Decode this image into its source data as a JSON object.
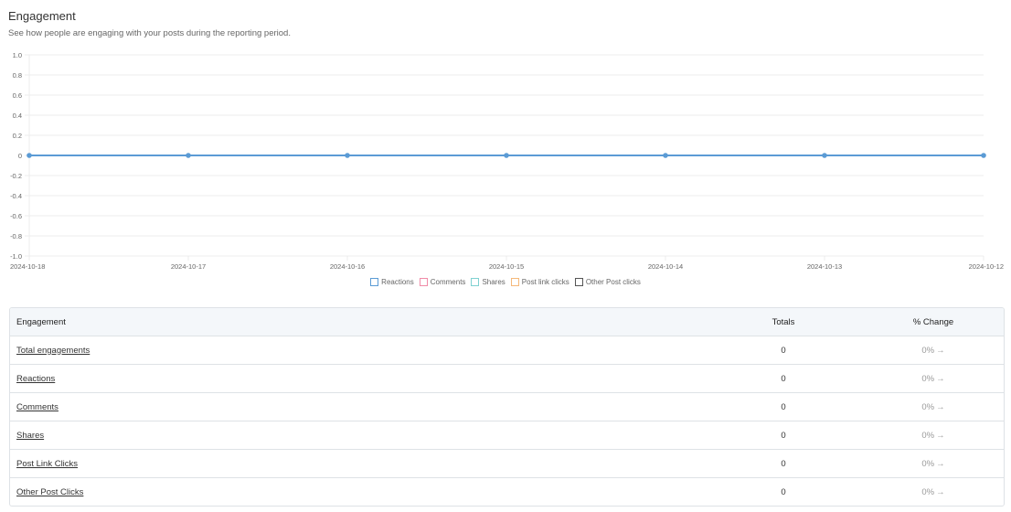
{
  "header": {
    "title": "Engagement",
    "subtitle": "See how people are engaging with your posts during the reporting period."
  },
  "chart_data": {
    "type": "line",
    "x": [
      "2024-10-18",
      "2024-10-17",
      "2024-10-16",
      "2024-10-15",
      "2024-10-14",
      "2024-10-13",
      "2024-10-12"
    ],
    "y_ticks": [
      "1.0",
      "0.8",
      "0.6",
      "0.4",
      "0.2",
      "0",
      "-0.2",
      "-0.4",
      "-0.6",
      "-0.8",
      "-1.0"
    ],
    "ylim": [
      -1.0,
      1.0
    ],
    "grid": true,
    "legend_position": "bottom",
    "series": [
      {
        "name": "Reactions",
        "values": [
          0,
          0,
          0,
          0,
          0,
          0,
          0
        ],
        "color": "#5b9bd5"
      },
      {
        "name": "Comments",
        "values": [
          0,
          0,
          0,
          0,
          0,
          0,
          0
        ],
        "color": "#f08ca8"
      },
      {
        "name": "Shares",
        "values": [
          0,
          0,
          0,
          0,
          0,
          0,
          0
        ],
        "color": "#7fd1d1"
      },
      {
        "name": "Post link clicks",
        "values": [
          0,
          0,
          0,
          0,
          0,
          0,
          0
        ],
        "color": "#f5b97a"
      },
      {
        "name": "Other Post clicks",
        "values": [
          0,
          0,
          0,
          0,
          0,
          0,
          0
        ],
        "color": "#555555"
      }
    ]
  },
  "table": {
    "headers": {
      "engagement": "Engagement",
      "totals": "Totals",
      "change": "% Change"
    },
    "rows": [
      {
        "label": "Total engagements",
        "total": "0",
        "change": "0%"
      },
      {
        "label": "Reactions",
        "total": "0",
        "change": "0%"
      },
      {
        "label": "Comments",
        "total": "0",
        "change": "0%"
      },
      {
        "label": "Shares",
        "total": "0",
        "change": "0%"
      },
      {
        "label": "Post Link Clicks",
        "total": "0",
        "change": "0%"
      },
      {
        "label": "Other Post Clicks",
        "total": "0",
        "change": "0%"
      }
    ],
    "change_arrow": "→"
  }
}
